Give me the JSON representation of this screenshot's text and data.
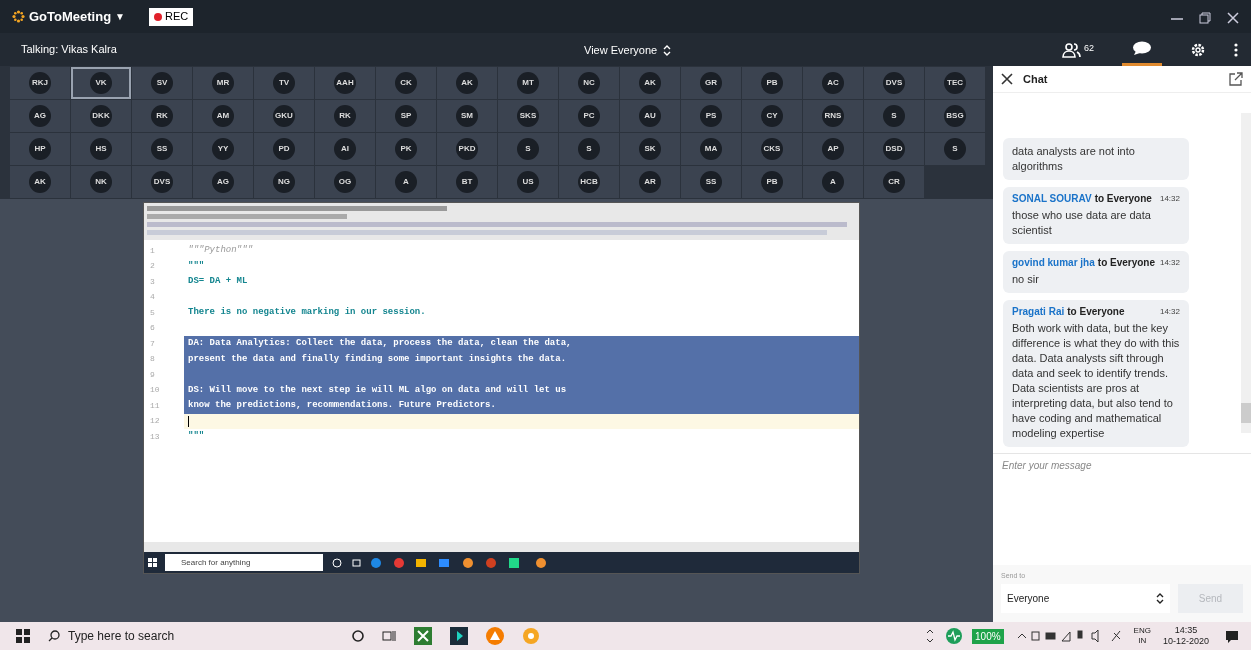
{
  "app": {
    "logo": "GoToMeeting",
    "menu_caret": "▼",
    "rec": "REC",
    "talking": "Talking: Vikas Kalra",
    "view": "View Everyone",
    "participant_count": "62"
  },
  "participants": [
    [
      {
        "initials": "RKJ",
        "selected": false
      },
      {
        "initials": "VK",
        "selected": true
      },
      {
        "initials": "SV",
        "selected": false
      },
      {
        "initials": "MR",
        "selected": false
      },
      {
        "initials": "TV",
        "selected": false
      },
      {
        "initials": "AAH",
        "selected": false
      },
      {
        "initials": "CK",
        "selected": false
      },
      {
        "initials": "AK",
        "selected": false
      },
      {
        "initials": "MT",
        "selected": false
      },
      {
        "initials": "NC",
        "selected": false
      },
      {
        "initials": "AK",
        "selected": false
      },
      {
        "initials": "GR",
        "selected": false
      },
      {
        "initials": "PB",
        "selected": false
      },
      {
        "initials": "AC",
        "selected": false
      },
      {
        "initials": "DVS",
        "selected": false
      },
      {
        "initials": "TEC",
        "selected": false
      }
    ],
    [
      {
        "initials": "AG",
        "selected": false
      },
      {
        "initials": "DKK",
        "selected": false
      },
      {
        "initials": "RK",
        "selected": false
      },
      {
        "initials": "AM",
        "selected": false
      },
      {
        "initials": "GKU",
        "selected": false
      },
      {
        "initials": "RK",
        "selected": false
      },
      {
        "initials": "SP",
        "selected": false
      },
      {
        "initials": "SM",
        "selected": false
      },
      {
        "initials": "SKS",
        "selected": false
      },
      {
        "initials": "PC",
        "selected": false
      },
      {
        "initials": "AU",
        "selected": false
      },
      {
        "initials": "PS",
        "selected": false
      },
      {
        "initials": "CY",
        "selected": false
      },
      {
        "initials": "RNS",
        "selected": false
      },
      {
        "initials": "S",
        "selected": false
      },
      {
        "initials": "BSG",
        "selected": false
      }
    ],
    [
      {
        "initials": "HP",
        "selected": false
      },
      {
        "initials": "HS",
        "selected": false
      },
      {
        "initials": "SS",
        "selected": false
      },
      {
        "initials": "YY",
        "selected": false
      },
      {
        "initials": "PD",
        "selected": false
      },
      {
        "initials": "AI",
        "selected": false
      },
      {
        "initials": "PK",
        "selected": false
      },
      {
        "initials": "PKD",
        "selected": false
      },
      {
        "initials": "S",
        "selected": false
      },
      {
        "initials": "S",
        "selected": false
      },
      {
        "initials": "SK",
        "selected": false
      },
      {
        "initials": "MA",
        "selected": false
      },
      {
        "initials": "CKS",
        "selected": false
      },
      {
        "initials": "AP",
        "selected": false
      },
      {
        "initials": "DSD",
        "selected": false
      },
      {
        "initials": "S",
        "selected": false
      }
    ],
    [
      {
        "initials": "AK",
        "selected": false
      },
      {
        "initials": "NK",
        "selected": false
      },
      {
        "initials": "DVS",
        "selected": false
      },
      {
        "initials": "AG",
        "selected": false
      },
      {
        "initials": "NG",
        "selected": false
      },
      {
        "initials": "OG",
        "selected": false
      },
      {
        "initials": "A",
        "selected": false
      },
      {
        "initials": "BT",
        "selected": false
      },
      {
        "initials": "US",
        "selected": false
      },
      {
        "initials": "HCB",
        "selected": false
      },
      {
        "initials": "AR",
        "selected": false
      },
      {
        "initials": "SS",
        "selected": false
      },
      {
        "initials": "PB",
        "selected": false
      },
      {
        "initials": "A",
        "selected": false
      },
      {
        "initials": "CR",
        "selected": false
      }
    ]
  ],
  "shared_screen": {
    "code_lines": [
      {
        "number": "1",
        "text": "\"\"\"Python\"\"\"",
        "kind": "docstring",
        "selected": false,
        "current": false
      },
      {
        "number": "2",
        "text": "\"\"\"",
        "kind": "code",
        "selected": false,
        "current": false
      },
      {
        "number": "3",
        "text": "DS= DA + ML",
        "kind": "code",
        "selected": false,
        "current": false
      },
      {
        "number": "4",
        "selected": false,
        "current": false
      },
      {
        "number": "5",
        "text": "There is no negative marking in our session.",
        "kind": "code",
        "selected": false,
        "current": false
      },
      {
        "number": "6",
        "selected": false,
        "current": false
      },
      {
        "number": "7",
        "text": "DA: Data Analytics: Collect the data, process the data, clean the data,",
        "kind": "code",
        "selected": true,
        "current": false
      },
      {
        "number": "8",
        "text": "present the data and finally finding some important insights the data.",
        "kind": "code",
        "selected": true,
        "current": false
      },
      {
        "number": "9",
        "selected": true,
        "current": false
      },
      {
        "number": "10",
        "text": "DS: Will move to the next step ie will ML algo on data and will let us",
        "kind": "code",
        "selected": true,
        "current": false
      },
      {
        "number": "11",
        "text": "know the predictions, recommendations. Future Predictors.",
        "kind": "code",
        "selected": true,
        "current": false
      },
      {
        "number": "12",
        "selected": false,
        "current": true
      },
      {
        "number": "13",
        "text": "\"\"\"",
        "kind": "code",
        "selected": false,
        "current": false
      }
    ],
    "taskbar_search": "Search for anything"
  },
  "chat": {
    "title": "Chat",
    "messages": [
      {
        "text": "data analysts are not into algorithms"
      },
      {
        "sender": "SONAL SOURAV",
        "recipient": "to Everyone",
        "time": "14:32",
        "text": "those who use data are data scientist"
      },
      {
        "sender": "govind  kumar jha",
        "recipient": "to Everyone",
        "time": "14:32",
        "text": "no sir"
      },
      {
        "sender": "Pragati Rai",
        "recipient": "to Everyone",
        "time": "14:32",
        "text": "Both work with data, but the key difference is what they do with this data. Data analysts sift through data and seek to identify trends. Data scientists are pros at interpreting data, but also tend to have coding and mathematical modeling expertise"
      }
    ],
    "placeholder": "Enter your message",
    "send_to_label": "Send to",
    "send_to": "Everyone",
    "send": "Send",
    "send_disabled": true
  },
  "taskbar": {
    "search_placeholder": "Type here to search",
    "battery": "100%",
    "language": "ENG",
    "region": "IN",
    "time": "14:35",
    "date": "10-12-2020"
  }
}
